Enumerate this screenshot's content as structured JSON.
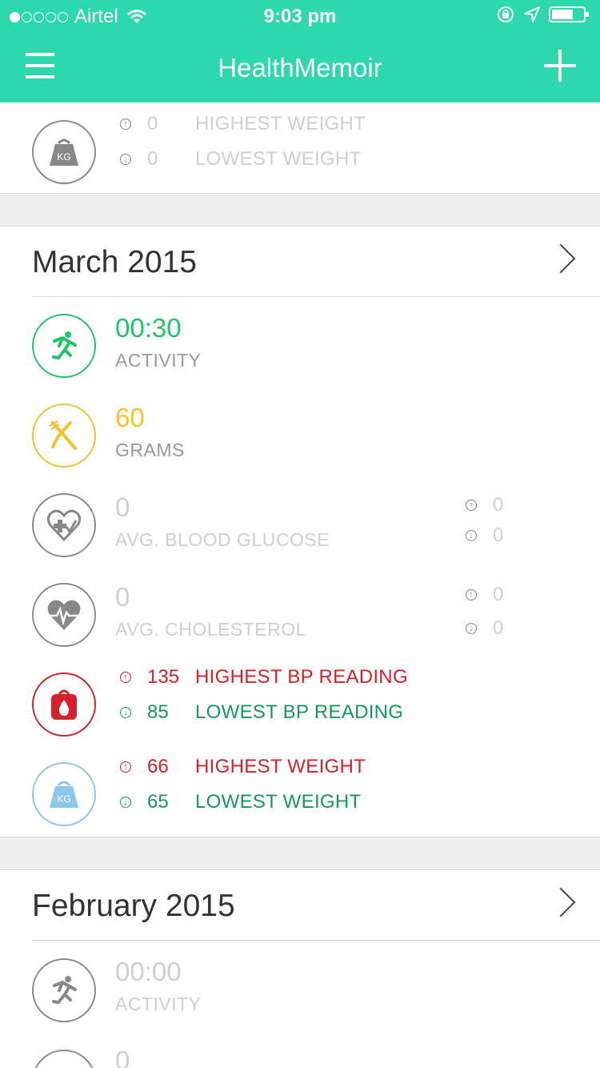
{
  "status_bar": {
    "carrier": "Airtel",
    "time": "9:03 pm"
  },
  "navbar": {
    "title": "HealthMemoir"
  },
  "top_weight": {
    "icon": "weight-icon",
    "highest_value": "0",
    "highest_label": "HIGHEST WEIGHT",
    "lowest_value": "0",
    "lowest_label": "LOWEST WEIGHT"
  },
  "march": {
    "title": "March 2015",
    "activity": {
      "value": "00:30",
      "label": "ACTIVITY"
    },
    "diet": {
      "value": "60",
      "label": "GRAMS"
    },
    "glucose": {
      "value": "0",
      "label": "AVG. BLOOD GLUCOSE",
      "high": "0",
      "low": "0"
    },
    "cholesterol": {
      "value": "0",
      "label": "AVG. CHOLESTEROL",
      "high": "0",
      "low": "0"
    },
    "bp": {
      "highest_value": "135",
      "highest_label": "HIGHEST BP READING",
      "lowest_value": "85",
      "lowest_label": "LOWEST BP READING"
    },
    "weight": {
      "highest_value": "66",
      "highest_label": "HIGHEST WEIGHT",
      "lowest_value": "65",
      "lowest_label": "LOWEST WEIGHT"
    }
  },
  "february": {
    "title": "February 2015",
    "activity": {
      "value": "00:00",
      "label": "ACTIVITY"
    },
    "next_value": "0"
  },
  "weight_icon_text": "KG",
  "colors": {
    "accent": "#2dd9ac",
    "green": "#22c46a",
    "yellow": "#f1c232",
    "red": "#d6202a",
    "blue": "#8cc8ec"
  }
}
